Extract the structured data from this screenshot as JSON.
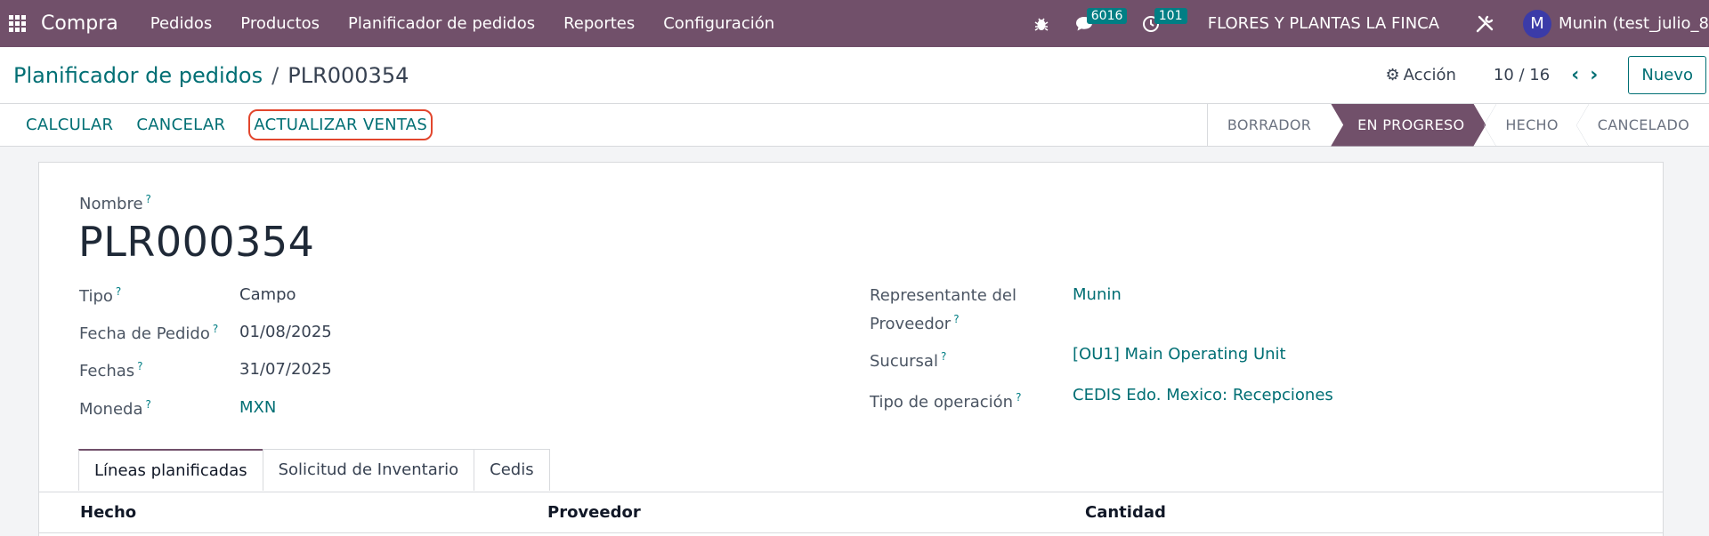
{
  "topbar": {
    "app_name": "Compra",
    "menu": [
      "Pedidos",
      "Productos",
      "Planificador de pedidos",
      "Reportes",
      "Configuración"
    ],
    "messages_count": "6016",
    "activities_count": "101",
    "company": "FLORES Y PLANTAS LA FINCA",
    "avatar_letter": "M",
    "user": "Munin (test_julio_8"
  },
  "control": {
    "breadcrumb_parent": "Planificador de pedidos",
    "breadcrumb_sep": "/",
    "breadcrumb_current": "PLR000354",
    "action_label": "Acción",
    "pager": "10 / 16",
    "new_label": "Nuevo"
  },
  "status": {
    "buttons": [
      "CALCULAR",
      "CANCELAR",
      "ACTUALIZAR VENTAS"
    ],
    "stages": [
      "BORRADOR",
      "EN PROGRESO",
      "HECHO",
      "CANCELADO"
    ],
    "active_stage": "EN PROGRESO"
  },
  "form": {
    "name_label": "Nombre",
    "name_value": "PLR000354",
    "left_fields": [
      {
        "label": "Tipo",
        "value": "Campo"
      },
      {
        "label": "Fecha de Pedido",
        "value": "01/08/2025"
      },
      {
        "label": "Fechas",
        "value": "31/07/2025"
      },
      {
        "label": "Moneda",
        "value": "MXN"
      }
    ],
    "right_fields": [
      {
        "label": "Representante del Proveedor",
        "value": "Munin"
      },
      {
        "label": "Sucursal",
        "value": "[OU1] Main Operating Unit"
      },
      {
        "label": "Tipo de operación",
        "value": "CEDIS Edo. Mexico: Recepciones"
      }
    ],
    "tabs": [
      "Líneas planificadas",
      "Solicitud de Inventario",
      "Cedis"
    ],
    "table_headers": [
      "Hecho",
      "Proveedor",
      "Cantidad"
    ]
  }
}
